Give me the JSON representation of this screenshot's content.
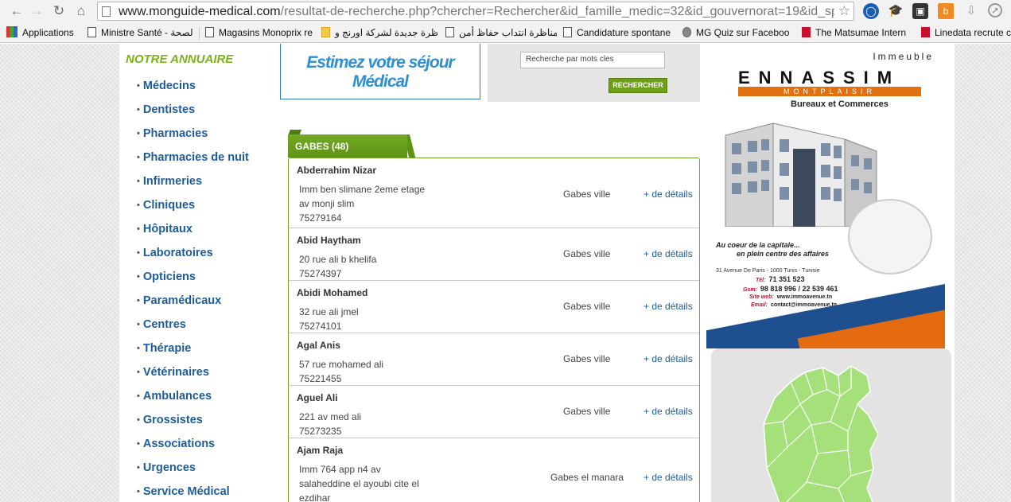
{
  "browser": {
    "url_host": "www.monguide-medical.com",
    "url_path": "/resultat-de-recherche.php?chercher=Rechercher&id_famille_medic=32&id_gouvernorat=19&id_sp",
    "bookmarks": [
      {
        "label": "Applications",
        "icon": "apps-grid-icon"
      },
      {
        "label": "Ministre Santé - الصحة",
        "icon": "page-icon"
      },
      {
        "label": "Magasins Monoprix re",
        "icon": "page-icon"
      },
      {
        "label": "مناظرة جديدة لشركة اورنج و",
        "icon": "logo-icon"
      },
      {
        "label": "فتح مناظرة انتداب حفاظ أمن",
        "icon": "page-icon"
      },
      {
        "label": "Candidature spontane",
        "icon": "page-icon"
      },
      {
        "label": "MG Quiz sur Faceboo",
        "icon": "gear-icon"
      },
      {
        "label": "The Matsumae Intern",
        "icon": "flag-icon"
      },
      {
        "label": "Linedata recrute c",
        "icon": "flag-icon"
      }
    ]
  },
  "sidebar": {
    "title": "NOTRE ANNUAIRE",
    "items": [
      "Médecins",
      "Dentistes",
      "Pharmacies",
      "Pharmacies de nuit",
      "Infirmeries",
      "Cliniques",
      "Hôpitaux",
      "Laboratoires",
      "Opticiens",
      "Paramédicaux",
      "Centres",
      "Thérapie",
      "Vétérinaires",
      "Ambulances",
      "Grossistes",
      "Associations",
      "Urgences",
      "Service Médical"
    ]
  },
  "banner": {
    "line1": "Estimez votre séjour",
    "line2": "Médical"
  },
  "search": {
    "placeholder": "Recherche par mots cles",
    "button": "RECHERCHER"
  },
  "results": {
    "tab_label": "GABES (48)",
    "details_label": "+ de détails",
    "rows": [
      {
        "name": "Abderrahim Nizar",
        "address": [
          "Imm ben slimane 2eme etage",
          "av monji slim"
        ],
        "phone": "75279164",
        "city": "Gabes ville"
      },
      {
        "name": "Abid Haytham",
        "address": [
          "20 rue ali b khelifa"
        ],
        "phone": "75274397",
        "city": "Gabes ville"
      },
      {
        "name": "Abidi Mohamed",
        "address": [
          "32 rue ali jmel"
        ],
        "phone": "75274101",
        "city": "Gabes ville"
      },
      {
        "name": "Agal Anis",
        "address": [
          "57 rue mohamed ali"
        ],
        "phone": "75221455",
        "city": "Gabes ville"
      },
      {
        "name": "Aguel Ali",
        "address": [
          "221 av med ali"
        ],
        "phone": "75273235",
        "city": "Gabes ville"
      },
      {
        "name": "Ajam Raja",
        "address": [
          "Imm 764 app n4 av",
          "salaheddine el ayoubi cite el",
          "ezdihar"
        ],
        "phone": "",
        "city": "Gabes el manara"
      }
    ]
  },
  "ad": {
    "immeuble": "Immeuble",
    "brand": "ENNASSIM",
    "sub": "MONTPLAISIR",
    "bureaux": "Bureaux et Commerces",
    "tagline1": "Au coeur de la capitale...",
    "tagline2": "en plein centre des affaires",
    "address": "31 Avenue De Paris - 1000 Tunis - Tunisie",
    "tel_label": "Tél:",
    "tel": "71 351 523",
    "gsm_label": "Gsm:",
    "gsm": "98 818 996 / 22 539 461",
    "web_label": "Site web:",
    "web": "www.immoavenue.tn",
    "email_label": "Email:",
    "email": "contact@immoavenue.tn"
  },
  "colors": {
    "link": "#1d5c9a",
    "accent_green": "#7ab317",
    "tab_green": "#6a9e1c",
    "map_green": "#a6e07a"
  }
}
